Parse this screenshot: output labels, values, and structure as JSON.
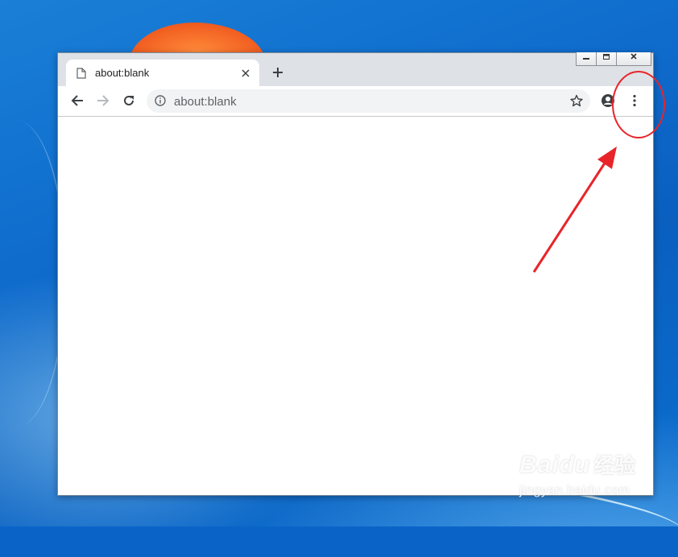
{
  "window": {
    "controls": {
      "minimize_icon": "minimize-icon",
      "restore_icon": "restore-icon",
      "close_icon": "close-icon"
    }
  },
  "tab": {
    "title": "about:blank",
    "icon": "page-icon",
    "close_glyph": "✕"
  },
  "new_tab_glyph": "+",
  "toolbar": {
    "back_icon": "back-arrow-icon",
    "forward_icon": "forward-arrow-icon",
    "reload_icon": "reload-icon",
    "profile_icon": "profile-icon",
    "menu_icon": "three-dot-menu-icon"
  },
  "omnibox": {
    "url": "about:blank",
    "info_icon": "info-icon",
    "bookmark_icon": "star-icon"
  },
  "annotation": {
    "color": "#e8242a",
    "target": "three-dot-menu-icon"
  },
  "watermark": {
    "logo": "Baidu",
    "cn": "经验",
    "url": "jingyan.baidu.com"
  }
}
